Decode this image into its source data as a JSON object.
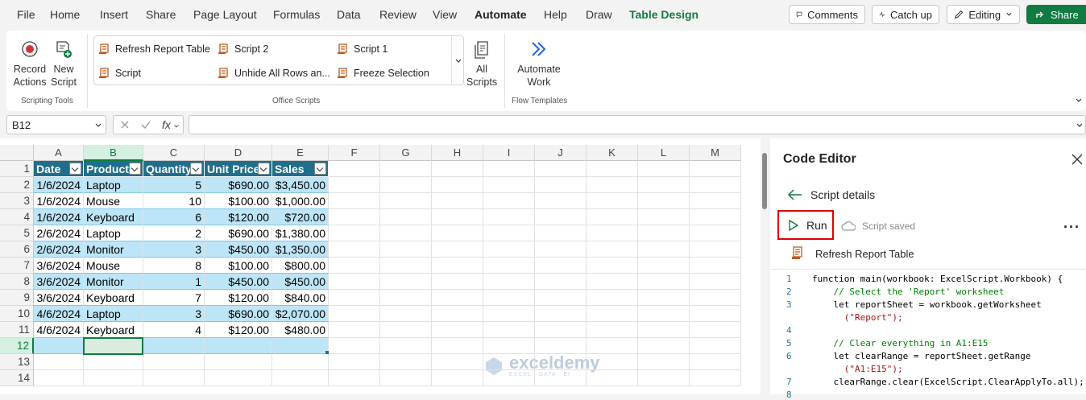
{
  "menu": {
    "tabs": [
      "File",
      "Home",
      "Insert",
      "Share",
      "Page Layout",
      "Formulas",
      "Data",
      "Review",
      "View",
      "Automate",
      "Help",
      "Draw",
      "Table Design"
    ],
    "comments": "Comments",
    "catchup": "Catch up",
    "editing": "Editing",
    "share": "Share"
  },
  "ribbon": {
    "record": [
      "Record",
      "Actions"
    ],
    "newscript": [
      "New",
      "Script"
    ],
    "tools_label": "Scripting Tools",
    "scripts": [
      "Refresh Report Table",
      "Script 2",
      "Script 1",
      "Script",
      "Unhide All Rows an...",
      "Freeze Selection"
    ],
    "office_label": "Office Scripts",
    "all": [
      "All",
      "Scripts"
    ],
    "automate": [
      "Automate",
      "Work"
    ],
    "flow_label": "Flow Templates"
  },
  "formula": {
    "namebox": "B12",
    "fx": "fx",
    "value": ""
  },
  "sheet": {
    "columns": [
      "A",
      "B",
      "C",
      "D",
      "E",
      "F",
      "G",
      "H",
      "I",
      "J",
      "K",
      "L",
      "M"
    ],
    "rows": [
      "1",
      "2",
      "3",
      "4",
      "5",
      "6",
      "7",
      "8",
      "9",
      "10",
      "11",
      "12",
      "13",
      "14"
    ],
    "headers": [
      "Date",
      "Product",
      "Quantity",
      "Unit Price",
      "Sales"
    ],
    "data": [
      [
        "1/6/2024",
        "Laptop",
        "5",
        "$690.00",
        "$3,450.00"
      ],
      [
        "1/6/2024",
        "Mouse",
        "10",
        "$100.00",
        "$1,000.00"
      ],
      [
        "1/6/2024",
        "Keyboard",
        "6",
        "$120.00",
        "$720.00"
      ],
      [
        "2/6/2024",
        "Laptop",
        "2",
        "$690.00",
        "$1,380.00"
      ],
      [
        "2/6/2024",
        "Monitor",
        "3",
        "$450.00",
        "$1,350.00"
      ],
      [
        "3/6/2024",
        "Mouse",
        "8",
        "$100.00",
        "$800.00"
      ],
      [
        "3/6/2024",
        "Monitor",
        "1",
        "$450.00",
        "$450.00"
      ],
      [
        "3/6/2024",
        "Keyboard",
        "7",
        "$120.00",
        "$840.00"
      ],
      [
        "4/6/2024",
        "Laptop",
        "3",
        "$690.00",
        "$2,070.00"
      ],
      [
        "4/6/2024",
        "Keyboard",
        "4",
        "$120.00",
        "$480.00"
      ]
    ]
  },
  "watermark": {
    "name": "exceldemy",
    "tag": "EXCEL · DATA · BI"
  },
  "editor": {
    "title": "Code Editor",
    "back": "Script details",
    "run": "Run",
    "saved": "Script saved",
    "script_name": "Refresh Report Table",
    "lines": [
      {
        "n": "1",
        "t": "function main(workbook: ExcelScript.Workbook) {"
      },
      {
        "n": "2",
        "t": "    // Select the 'Report' worksheet"
      },
      {
        "n": "3",
        "t": "    let reportSheet = workbook.getWorksheet"
      },
      {
        "n": "",
        "t": "      (\"Report\");"
      },
      {
        "n": "4",
        "t": ""
      },
      {
        "n": "5",
        "t": "    // Clear everything in A1:E15"
      },
      {
        "n": "6",
        "t": "    let clearRange = reportSheet.getRange"
      },
      {
        "n": "",
        "t": "      (\"A1:E15\");"
      },
      {
        "n": "7",
        "t": "    clearRange.clear(ExcelScript.ClearApplyTo.all);"
      },
      {
        "n": "8",
        "t": ""
      }
    ]
  }
}
